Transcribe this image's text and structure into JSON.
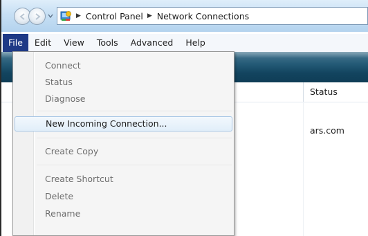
{
  "address": {
    "crumbs": [
      "Control Panel",
      "Network Connections"
    ]
  },
  "menubar": {
    "items": [
      {
        "label": "File",
        "active": true
      },
      {
        "label": "Edit"
      },
      {
        "label": "View"
      },
      {
        "label": "Tools"
      },
      {
        "label": "Advanced"
      },
      {
        "label": "Help"
      }
    ]
  },
  "list": {
    "status_header": "Status",
    "row_status": "ars.com"
  },
  "file_menu": {
    "items": [
      {
        "label": "Connect",
        "enabled": false
      },
      {
        "label": "Status",
        "enabled": false
      },
      {
        "label": "Diagnose",
        "enabled": false
      },
      {
        "label": "New Incoming Connection...",
        "enabled": true,
        "highlighted": true
      },
      {
        "label": "Create Copy",
        "enabled": false
      },
      {
        "label": "Create Shortcut",
        "enabled": false
      },
      {
        "label": "Delete",
        "enabled": false
      },
      {
        "label": "Rename",
        "enabled": false
      }
    ]
  },
  "colors": {
    "menu_active_bg": "#1f3a86",
    "toolbar_blue": "#12445f",
    "highlight_border": "#a9c7e6"
  },
  "icons": {
    "back": "arrow-left-icon",
    "forward": "arrow-right-icon",
    "history": "chevron-down-icon",
    "location": "control-panel-icon",
    "separator": "triangle-right-icon"
  }
}
